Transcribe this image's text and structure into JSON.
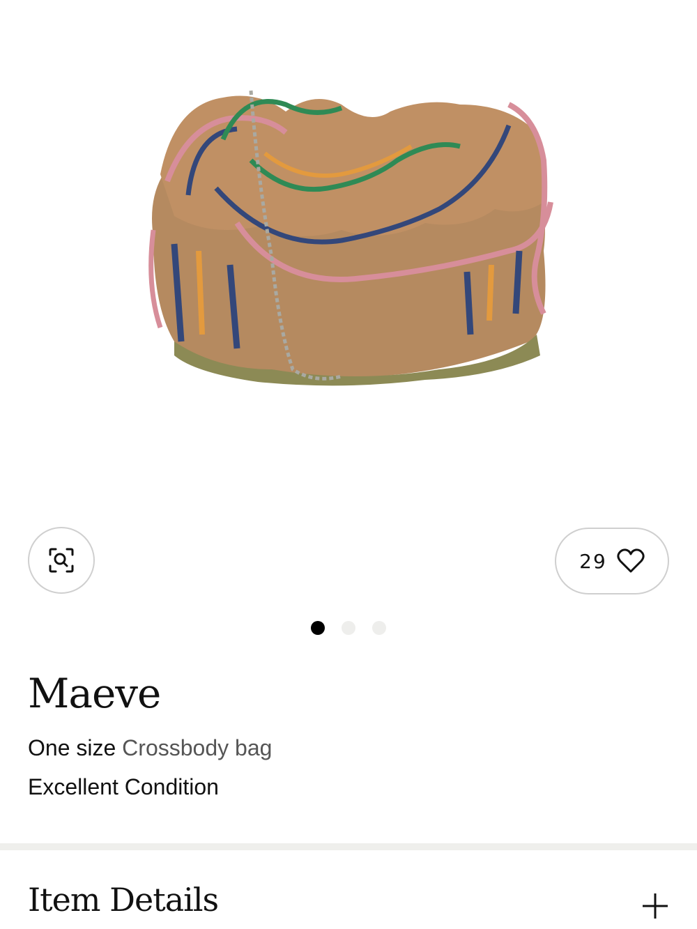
{
  "product": {
    "brand": "Maeve",
    "size": "One size",
    "category": "Crossbody bag",
    "condition": "Excellent Condition"
  },
  "favorites": {
    "count": "29",
    "icon": "heart-outline-icon"
  },
  "visual_search": {
    "icon": "image-search-icon"
  },
  "carousel": {
    "total": 3,
    "active_index": 0
  },
  "sections": {
    "item_details_title": "Item Details",
    "expand_icon": "plus-icon"
  },
  "colors": {
    "text": "#111111",
    "muted_link": "#555555",
    "divider": "#efefec",
    "dot_inactive": "#eeeeec"
  }
}
